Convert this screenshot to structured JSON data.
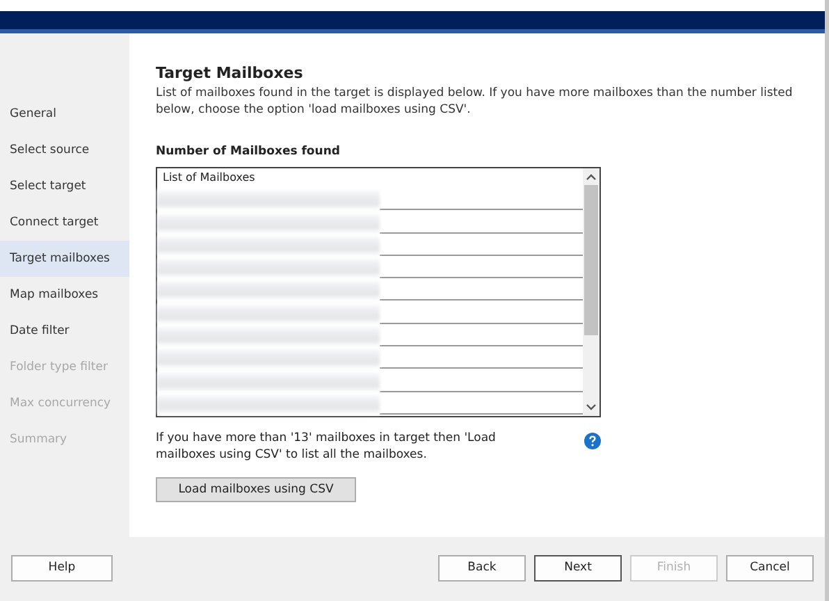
{
  "sidebar": {
    "items": [
      {
        "label": "General",
        "selected": false,
        "disabled": false
      },
      {
        "label": "Select source",
        "selected": false,
        "disabled": false
      },
      {
        "label": "Select target",
        "selected": false,
        "disabled": false
      },
      {
        "label": "Connect target",
        "selected": false,
        "disabled": false
      },
      {
        "label": "Target mailboxes",
        "selected": true,
        "disabled": false
      },
      {
        "label": "Map mailboxes",
        "selected": false,
        "disabled": false
      },
      {
        "label": "Date filter",
        "selected": false,
        "disabled": false
      },
      {
        "label": "Folder type filter",
        "selected": false,
        "disabled": true
      },
      {
        "label": "Max concurrency",
        "selected": false,
        "disabled": true
      },
      {
        "label": "Summary",
        "selected": false,
        "disabled": true
      }
    ]
  },
  "content": {
    "title": "Target Mailboxes",
    "description": "List of mailboxes found in the target is displayed below. If you have more mailboxes than the number listed below, choose the option 'load mailboxes using CSV'.",
    "section_title": "Number of Mailboxes found",
    "list": {
      "header": "List of Mailboxes",
      "rows": [
        {
          "kind": "redacted"
        },
        {
          "kind": "redacted"
        },
        {
          "kind": "redacted"
        },
        {
          "kind": "redacted"
        },
        {
          "kind": "redacted"
        },
        {
          "kind": "redacted"
        },
        {
          "kind": "redacted"
        },
        {
          "kind": "redacted"
        },
        {
          "kind": "redacted"
        },
        {
          "kind": "redacted"
        }
      ]
    },
    "help_text": "If you have more than '13' mailboxes in target then 'Load mailboxes using CSV' to list all the mailboxes.",
    "load_button": "Load mailboxes using CSV"
  },
  "footer": {
    "help_button": "Help",
    "buttons": [
      {
        "label": "Back",
        "disabled": false,
        "default": false
      },
      {
        "label": "Next",
        "disabled": false,
        "default": true
      },
      {
        "label": "Finish",
        "disabled": true,
        "default": false
      },
      {
        "label": "Cancel",
        "disabled": false,
        "default": false
      }
    ]
  }
}
